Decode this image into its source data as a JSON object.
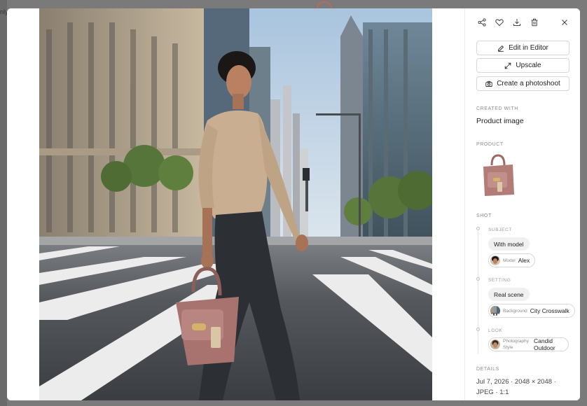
{
  "background": {
    "partial_text": "nly"
  },
  "panel": {
    "toolbar": {
      "share": "share-icon",
      "favorite": "heart-icon",
      "download": "download-icon",
      "delete": "trash-icon",
      "close": "close-icon"
    },
    "actions": [
      {
        "label": "Edit in Editor",
        "icon": "pencil-icon"
      },
      {
        "label": "Upscale",
        "icon": "expand-icon"
      },
      {
        "label": "Create a photoshoot",
        "icon": "camera-icon"
      }
    ],
    "created_with": {
      "label": "CREATED WITH",
      "value": "Product image"
    },
    "product": {
      "label": "PRODUCT"
    },
    "shot": {
      "label": "SHOT",
      "subject": {
        "label": "SUBJECT",
        "pill": "With model",
        "chip_key": "Model",
        "chip_value": "Alex"
      },
      "setting": {
        "label": "SETTING",
        "pill": "Real scene",
        "chip_key": "Background",
        "chip_value": "City Crosswalk"
      },
      "look": {
        "label": "LOOK",
        "chip_key": "Photography Style",
        "chip_value": "Candid Outdoor"
      }
    },
    "details": {
      "label": "DETAILS",
      "value": "Jul 7, 2026 · 2048 × 2048 · JPEG · 1:1"
    }
  },
  "colors": {
    "accent_bag": "#a8736e",
    "modal_bg": "#ffffff",
    "overlay": "#7a7a7a"
  }
}
